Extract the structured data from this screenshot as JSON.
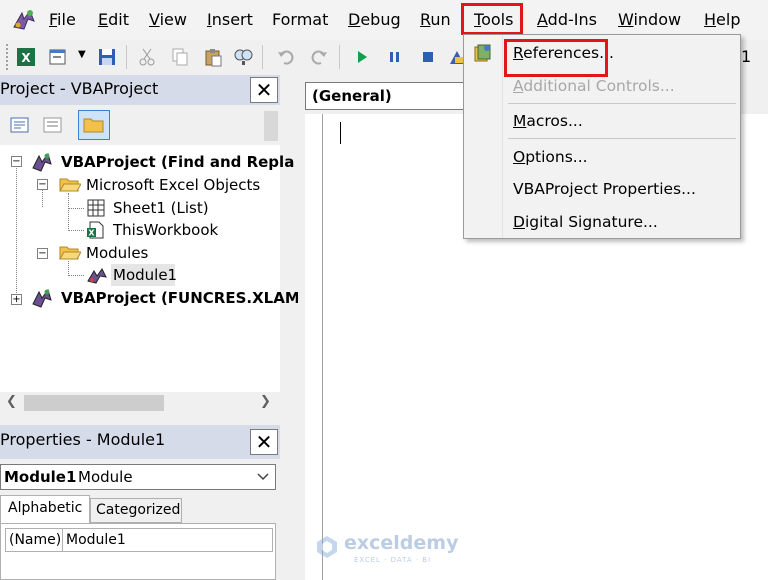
{
  "menubar": {
    "items": [
      "File",
      "Edit",
      "View",
      "Insert",
      "Format",
      "Debug",
      "Run",
      "Tools",
      "Add-Ins",
      "Window",
      "Help"
    ]
  },
  "project_pane": {
    "title": "Project - VBAProject",
    "close": "✕",
    "tree": {
      "root1": "VBAProject (Find and Repla",
      "folder_objects": "Microsoft Excel Objects",
      "sheet1": "Sheet1 (List)",
      "thisworkbook": "ThisWorkbook",
      "folder_modules": "Modules",
      "module1": "Module1",
      "root2": "VBAProject (FUNCRES.XLAM"
    }
  },
  "properties_pane": {
    "title": "Properties - Module1",
    "close": "✕",
    "object_name": "Module1",
    "object_type": "Module",
    "tabs": [
      "Alphabetic",
      "Categorized"
    ],
    "grid_rows": [
      {
        "name": "(Name)",
        "value": "Module1"
      }
    ]
  },
  "code_window": {
    "object_combo": "(General)"
  },
  "tools_menu": {
    "items": [
      {
        "label": "References...",
        "enabled": true
      },
      {
        "label": "Additional Controls...",
        "enabled": false
      },
      {
        "label": "Macros...",
        "enabled": true
      },
      {
        "label": "Options...",
        "enabled": true
      },
      {
        "label": "VBAProject Properties...",
        "enabled": true
      },
      {
        "label": "Digital Signature...",
        "enabled": true
      }
    ]
  },
  "toolbar": {
    "right_number": "1"
  },
  "watermark": {
    "name": "exceldemy",
    "tagline": "EXCEL · DATA · BI"
  },
  "colors": {
    "highlight_red": "#e0161b",
    "pane_title_bg": "#d6dbe9",
    "menu_bg": "#f2f2f2"
  }
}
